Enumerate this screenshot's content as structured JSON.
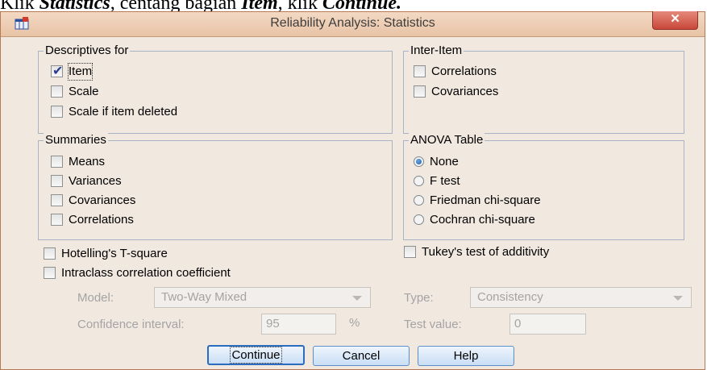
{
  "caption": {
    "prefix": "Klik ",
    "statistics": "Statistics",
    "middle": ", centang bagian ",
    "item": "Item",
    "middle2": ", klik ",
    "continue": "Continue."
  },
  "window": {
    "title": "Reliability Analysis: Statistics",
    "close_symbol": "✕",
    "app_icon": "spss-table-icon"
  },
  "descriptives": {
    "legend": "Descriptives for",
    "items": [
      {
        "label": "Item",
        "checked": true
      },
      {
        "label": "Scale",
        "checked": false
      },
      {
        "label": "Scale if item deleted",
        "checked": false
      }
    ]
  },
  "inter_item": {
    "legend": "Inter-Item",
    "items": [
      {
        "label": "Correlations",
        "checked": false
      },
      {
        "label": "Covariances",
        "checked": false
      }
    ]
  },
  "summaries": {
    "legend": "Summaries",
    "items": [
      {
        "label": "Means",
        "checked": false
      },
      {
        "label": "Variances",
        "checked": false
      },
      {
        "label": "Covariances",
        "checked": false
      },
      {
        "label": "Correlations",
        "checked": false
      }
    ]
  },
  "anova": {
    "legend": "ANOVA Table",
    "options": [
      {
        "label": "None",
        "selected": true
      },
      {
        "label": "F test",
        "selected": false
      },
      {
        "label": "Friedman chi-square",
        "selected": false
      },
      {
        "label": "Cochran chi-square",
        "selected": false
      }
    ]
  },
  "hotelling": {
    "label": "Hotelling's T-square",
    "checked": false
  },
  "tukey": {
    "label": "Tukey's test of additivity",
    "checked": false
  },
  "intraclass": {
    "label": "Intraclass correlation coefficient",
    "checked": false
  },
  "model": {
    "label": "Model:",
    "value": "Two-Way Mixed"
  },
  "type": {
    "label": "Type:",
    "value": "Consistency"
  },
  "confidence": {
    "label": "Confidence interval:",
    "value": "95",
    "unit": "%"
  },
  "test_value": {
    "label": "Test value:",
    "value": "0"
  },
  "buttons": {
    "continue": "Continue",
    "cancel": "Cancel",
    "help": "Help"
  },
  "colors": {
    "title_bar": "#e8c3a5",
    "close_button": "#c9473a",
    "dialog_bg": "#f1e8e0",
    "button_border": "#5a8fc8"
  }
}
